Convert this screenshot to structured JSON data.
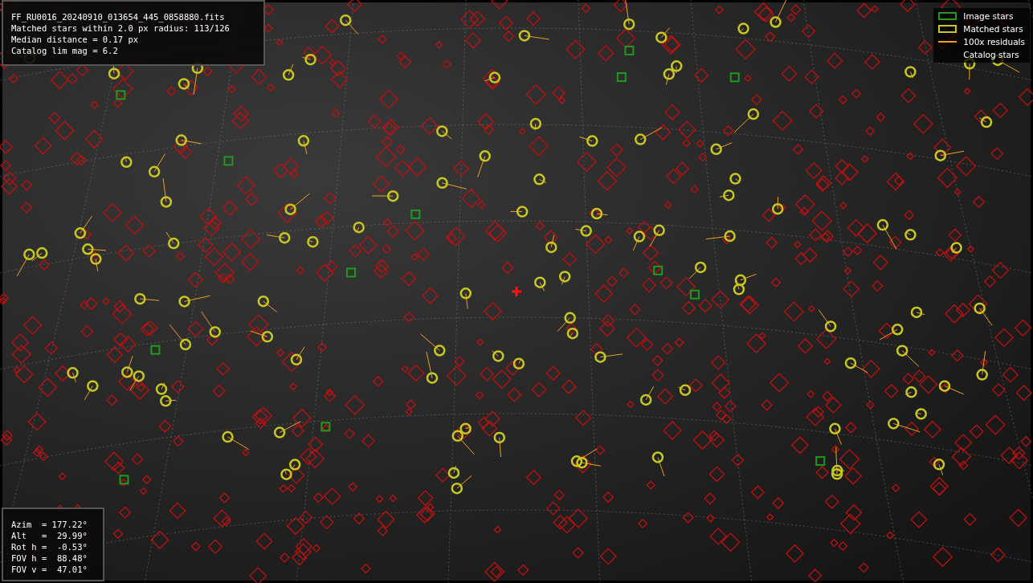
{
  "info_panel": {
    "lines": [
      "FF_RU0016_20240910_013654_445_0858880.fits",
      "Matched stars within 2.0 px radius: 113/126",
      "Median distance = 0.17 px",
      "Catalog lim mag = 6.2"
    ]
  },
  "legend": [
    {
      "kind": "box",
      "color": "#1e9a1e",
      "label": "Image stars"
    },
    {
      "kind": "box",
      "color": "#c8c81e",
      "label": "Matched stars"
    },
    {
      "kind": "line",
      "color": "#f0a020",
      "label": "100x residuals"
    },
    {
      "kind": "none",
      "label": "Catalog stars"
    }
  ],
  "pointing_panel": {
    "lines": [
      "Azim  = 177.22°",
      "Alt   =  29.99°",
      "Rot h =  -0.53°",
      "FOV h =  88.48°",
      "FOV v =  47.01°"
    ]
  }
}
